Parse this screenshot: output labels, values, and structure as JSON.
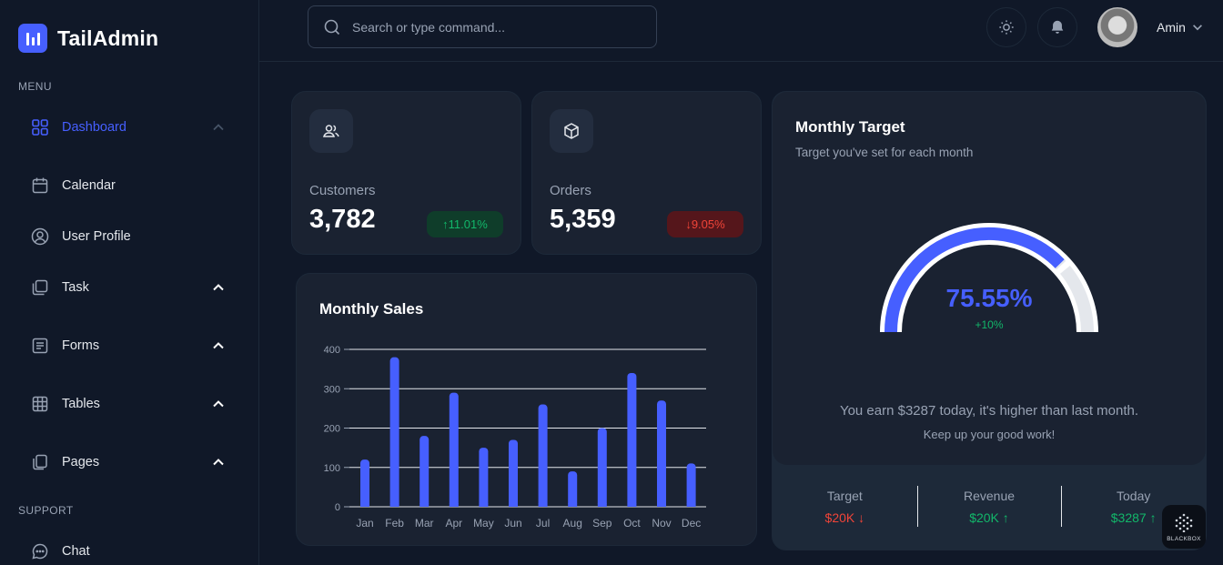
{
  "app": {
    "name": "TailAdmin"
  },
  "sidebar": {
    "menu_label": "MENU",
    "support_label": "SUPPORT",
    "items": [
      {
        "label": "Dashboard",
        "icon": "grid-icon",
        "active": true
      },
      {
        "label": "Calendar",
        "icon": "calendar-icon"
      },
      {
        "label": "User Profile",
        "icon": "user-circle-icon"
      },
      {
        "label": "Task",
        "icon": "task-icon"
      },
      {
        "label": "Forms",
        "icon": "form-icon"
      },
      {
        "label": "Tables",
        "icon": "table-icon"
      },
      {
        "label": "Pages",
        "icon": "pages-icon"
      }
    ],
    "support_items": [
      {
        "label": "Chat",
        "icon": "chat-icon"
      }
    ]
  },
  "header": {
    "search_placeholder": "Search or type command...",
    "user_name": "Amin"
  },
  "metrics": [
    {
      "label": "Customers",
      "value": "3,782",
      "change": "11.01%",
      "direction": "up",
      "icon": "users-icon"
    },
    {
      "label": "Orders",
      "value": "5,359",
      "change": "9.05%",
      "direction": "down",
      "icon": "box-icon"
    }
  ],
  "monthly_sales": {
    "title": "Monthly Sales"
  },
  "chart_data": {
    "type": "bar",
    "title": "Monthly Sales",
    "categories": [
      "Jan",
      "Feb",
      "Mar",
      "Apr",
      "May",
      "Jun",
      "Jul",
      "Aug",
      "Sep",
      "Oct",
      "Nov",
      "Dec"
    ],
    "values": [
      120,
      380,
      180,
      290,
      150,
      170,
      260,
      90,
      200,
      340,
      270,
      110
    ],
    "yticks": [
      0,
      100,
      200,
      300,
      400
    ],
    "ylim": [
      0,
      400
    ],
    "xlabel": "",
    "ylabel": "",
    "grid": true,
    "bar_color": "#465fff"
  },
  "monthly_target": {
    "title": "Monthly Target",
    "subtitle": "Target you've set for each month",
    "progress_percent": 75.55,
    "progress_label": "75.55%",
    "change": "+10%",
    "message": "You earn $3287 today, it's higher than last month.",
    "message2": "Keep up your good work!",
    "stats": [
      {
        "label": "Target",
        "value": "$20K",
        "direction": "down"
      },
      {
        "label": "Revenue",
        "value": "$20K",
        "direction": "up"
      },
      {
        "label": "Today",
        "value": "$3287",
        "direction": "up"
      }
    ]
  },
  "watermark": {
    "label": "BLACKBOX"
  },
  "colors": {
    "accent": "#465fff",
    "success": "#12b76a",
    "danger": "#f04438",
    "background": "#101828",
    "card": "#1a2231"
  }
}
